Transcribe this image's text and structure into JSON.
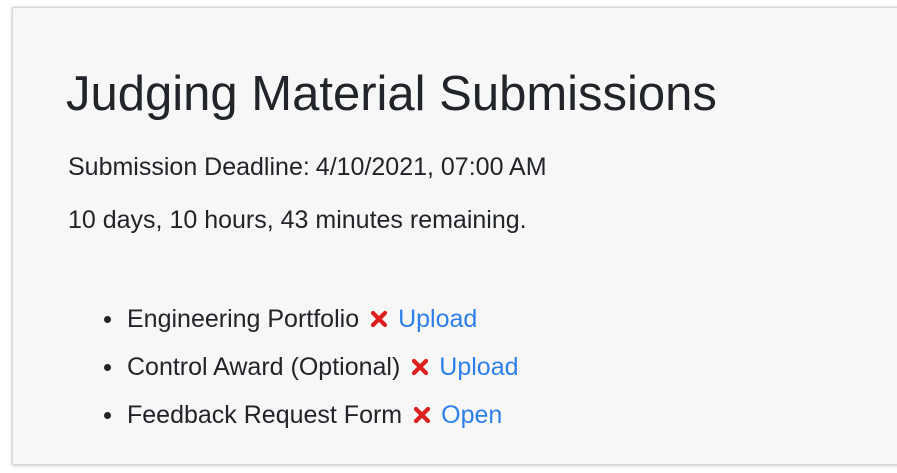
{
  "page": {
    "title": "Judging Material Submissions",
    "deadline_label": "Submission Deadline:",
    "deadline_value": "4/10/2021, 07:00 AM",
    "remaining": "10 days, 10 hours, 43 minutes remaining."
  },
  "items": [
    {
      "label": "Engineering Portfolio",
      "status_icon": "x-mark-icon",
      "status_color": "#e02020",
      "action": "Upload"
    },
    {
      "label": "Control Award (Optional)",
      "status_icon": "x-mark-icon",
      "status_color": "#e02020",
      "action": "Upload"
    },
    {
      "label": "Feedback Request Form",
      "status_icon": "x-mark-icon",
      "status_color": "#e02020",
      "action": "Open"
    }
  ],
  "colors": {
    "link": "#2f80ed",
    "text": "#212529",
    "status_missing": "#e02020",
    "card_background": "#f7f7f7"
  }
}
